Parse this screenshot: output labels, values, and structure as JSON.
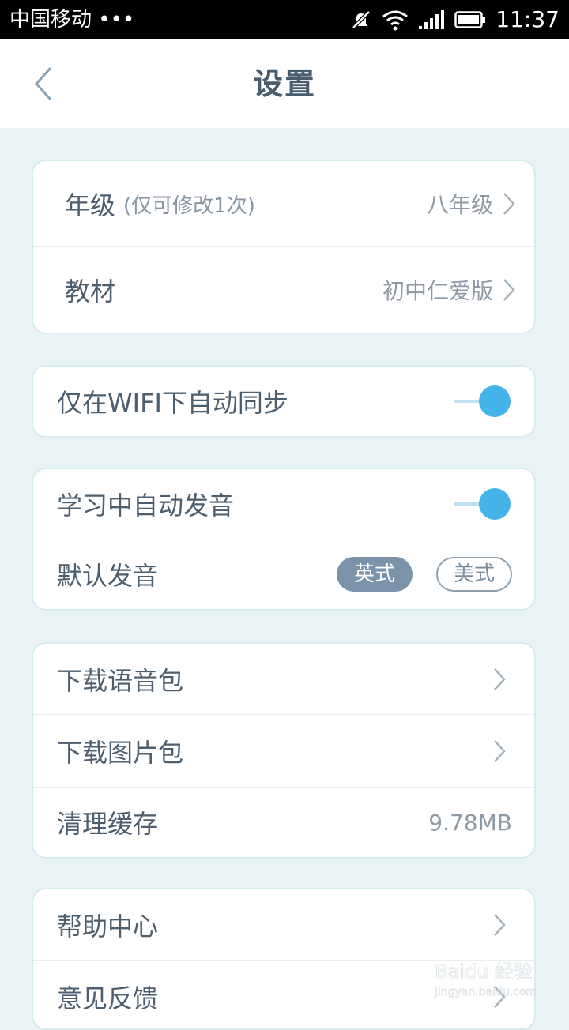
{
  "status_bar": {
    "carrier": "中国移动 •••",
    "time": "11:37",
    "icons": [
      "mute-icon",
      "wifi-icon",
      "signal-icon",
      "battery-icon"
    ]
  },
  "header": {
    "title": "设置",
    "back_icon": "chevron-left-icon"
  },
  "sections": {
    "grade_textbook": {
      "grade_label": "年级",
      "grade_note": "(仅可修改1次)",
      "grade_value": "八年级",
      "textbook_label": "教材",
      "textbook_value": "初中仁爱版"
    },
    "sync": {
      "wifi_sync_label": "仅在WIFI下自动同步",
      "wifi_sync_on": true
    },
    "pronunciation": {
      "auto_label": "学习中自动发音",
      "auto_on": true,
      "default_label": "默认发音",
      "option_british": "英式",
      "option_american": "美式",
      "selected": "英式"
    },
    "storage": {
      "voice_pack_label": "下载语音包",
      "image_pack_label": "下载图片包",
      "clear_cache_label": "清理缓存",
      "cache_size": "9.78MB"
    },
    "support": {
      "help_label": "帮助中心",
      "feedback_label": "意见反馈"
    }
  },
  "watermark": {
    "line1": "Baidu 经验",
    "line2": "jingyan.baidu.com"
  },
  "colors": {
    "accent": "#44b4e8",
    "background": "#e9f3f5",
    "text": "#4d5e6e",
    "selected_pill": "#7a93a8"
  }
}
